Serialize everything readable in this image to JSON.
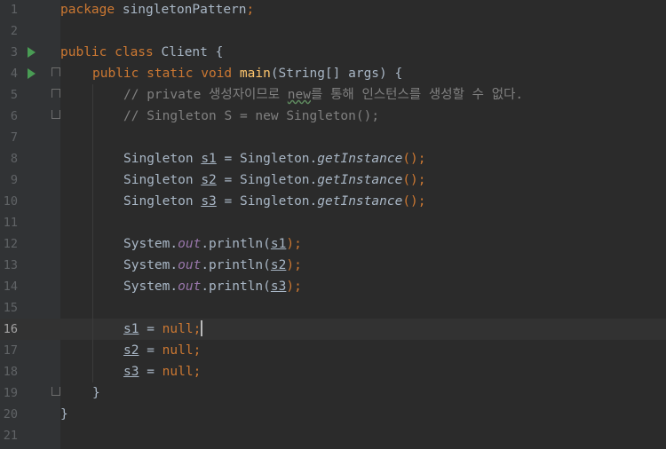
{
  "editor": {
    "current_line": 16,
    "lines": [
      {
        "n": "1",
        "kw_package": "package",
        "pkg": " singletonPattern",
        "semi": ";"
      },
      {
        "n": "2"
      },
      {
        "n": "3",
        "kw_public": "public",
        "kw_class": " class",
        "cls": " Client {"
      },
      {
        "n": "4",
        "kw_public": "public",
        "kw_static": " static",
        "kw_void": " void",
        "fn": " main",
        "sig": "(String[] args) {"
      },
      {
        "n": "5",
        "cm1": "// private 생성자이므로 ",
        "cm_new": "new",
        "cm2": "를 통해 인스턴스를 생성할 수 없다."
      },
      {
        "n": "6",
        "cm": "// Singleton S = new Singleton();"
      },
      {
        "n": "7"
      },
      {
        "n": "8",
        "type": "Singleton ",
        "var": "s1",
        "eq": " = Singleton.",
        "call": "getInstance",
        "tail": "();"
      },
      {
        "n": "9",
        "type": "Singleton ",
        "var": "s2",
        "eq": " = Singleton.",
        "call": "getInstance",
        "tail": "();"
      },
      {
        "n": "10",
        "type": "Singleton ",
        "var": "s3",
        "eq": " = Singleton.",
        "call": "getInstance",
        "tail": "();"
      },
      {
        "n": "11"
      },
      {
        "n": "12",
        "sys": "System.",
        "out": "out",
        "pr": ".println(",
        "var": "s1",
        "close": ");"
      },
      {
        "n": "13",
        "sys": "System.",
        "out": "out",
        "pr": ".println(",
        "var": "s2",
        "close": ");"
      },
      {
        "n": "14",
        "sys": "System.",
        "out": "out",
        "pr": ".println(",
        "var": "s3",
        "close": ");"
      },
      {
        "n": "15"
      },
      {
        "n": "16",
        "var": "s1",
        "eq": " = ",
        "null": "null",
        "semi": ";"
      },
      {
        "n": "17",
        "var": "s2",
        "eq": " = ",
        "null": "null",
        "semi": ";"
      },
      {
        "n": "18",
        "var": "s3",
        "eq": " = ",
        "null": "null",
        "semi": ";"
      },
      {
        "n": "19",
        "brace": "}"
      },
      {
        "n": "20",
        "brace": "}"
      },
      {
        "n": "21"
      }
    ]
  },
  "colors": {
    "background": "#2b2b2b",
    "keyword": "#cc7832",
    "function": "#ffc66d",
    "comment": "#808080",
    "static_field": "#9876aa",
    "text": "#a9b7c6",
    "run": "#499c54"
  },
  "icons": [
    "run-icon",
    "fold-icon"
  ]
}
